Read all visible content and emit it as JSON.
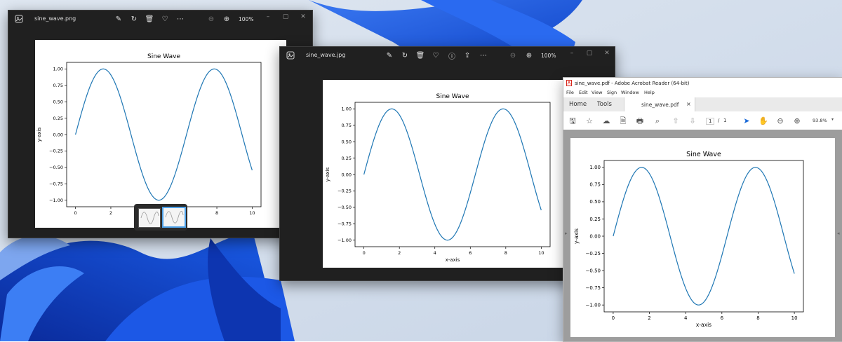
{
  "colors": {
    "series": "#1f77b4",
    "viewer_bg": "#202020",
    "accent": "#4ea1e8",
    "acrobat_red": "#d9281e"
  },
  "photos_window_1": {
    "title": "sine_wave.png",
    "zoom": "100%",
    "toolbar_icons": [
      "edit-icon",
      "rotate-icon",
      "delete-icon",
      "favorite-icon",
      "more-icon"
    ]
  },
  "photos_window_2": {
    "title": "sine_wave.jpg",
    "zoom": "100%",
    "toolbar_icons": [
      "edit-icon",
      "rotate-icon",
      "delete-icon",
      "favorite-icon",
      "info-icon",
      "share-icon",
      "more-icon"
    ]
  },
  "acrobat": {
    "title": "sine_wave.pdf - Adobe Acrobat Reader (64-bit)",
    "menu": [
      "File",
      "Edit",
      "View",
      "Sign",
      "Window",
      "Help"
    ],
    "tabs": {
      "home": "Home",
      "tools": "Tools",
      "document": "sine_wave.pdf",
      "close": "×"
    },
    "page_current": "1",
    "page_sep": "/",
    "page_total": "1",
    "zoom": "93.8%"
  },
  "chart_data": [
    {
      "id": "png",
      "type": "line",
      "title": "Sine Wave",
      "xlabel": "",
      "ylabel": "y-axis",
      "xlim": [
        -0.5,
        10.5
      ],
      "ylim": [
        -1.1,
        1.1
      ],
      "xticks": [
        "0",
        "2",
        "8",
        "10"
      ],
      "yticks": [
        "1.00",
        "0.75",
        "0.50",
        "0.25",
        "0.00",
        "−0.25",
        "−0.50",
        "−0.75",
        "−1.00"
      ],
      "series": [
        {
          "function": "sin(x)",
          "x_range": [
            0,
            10
          ]
        }
      ],
      "grid": false,
      "legend": "none"
    },
    {
      "id": "jpg",
      "type": "line",
      "title": "Sine Wave",
      "xlabel": "x-axis",
      "ylabel": "y-axis",
      "xlim": [
        -0.5,
        10.5
      ],
      "ylim": [
        -1.1,
        1.1
      ],
      "xticks": [
        "0",
        "2",
        "4",
        "6",
        "8",
        "10"
      ],
      "yticks": [
        "1.00",
        "0.75",
        "0.50",
        "0.25",
        "0.00",
        "−0.25",
        "−0.50",
        "−0.75",
        "−1.00"
      ],
      "series": [
        {
          "function": "sin(x)",
          "x_range": [
            0,
            10
          ]
        }
      ],
      "grid": false,
      "legend": "none"
    },
    {
      "id": "pdf",
      "type": "line",
      "title": "Sine Wave",
      "xlabel": "x-axis",
      "ylabel": "y-axis",
      "xlim": [
        -0.5,
        10.5
      ],
      "ylim": [
        -1.1,
        1.1
      ],
      "xticks": [
        "0",
        "2",
        "4",
        "6",
        "8",
        "10"
      ],
      "yticks": [
        "1.00",
        "0.75",
        "0.50",
        "0.25",
        "0.00",
        "−0.25",
        "−0.50",
        "−0.75",
        "−1.00"
      ],
      "series": [
        {
          "function": "sin(x)",
          "x_range": [
            0,
            10
          ]
        }
      ],
      "grid": false,
      "legend": "none"
    }
  ]
}
